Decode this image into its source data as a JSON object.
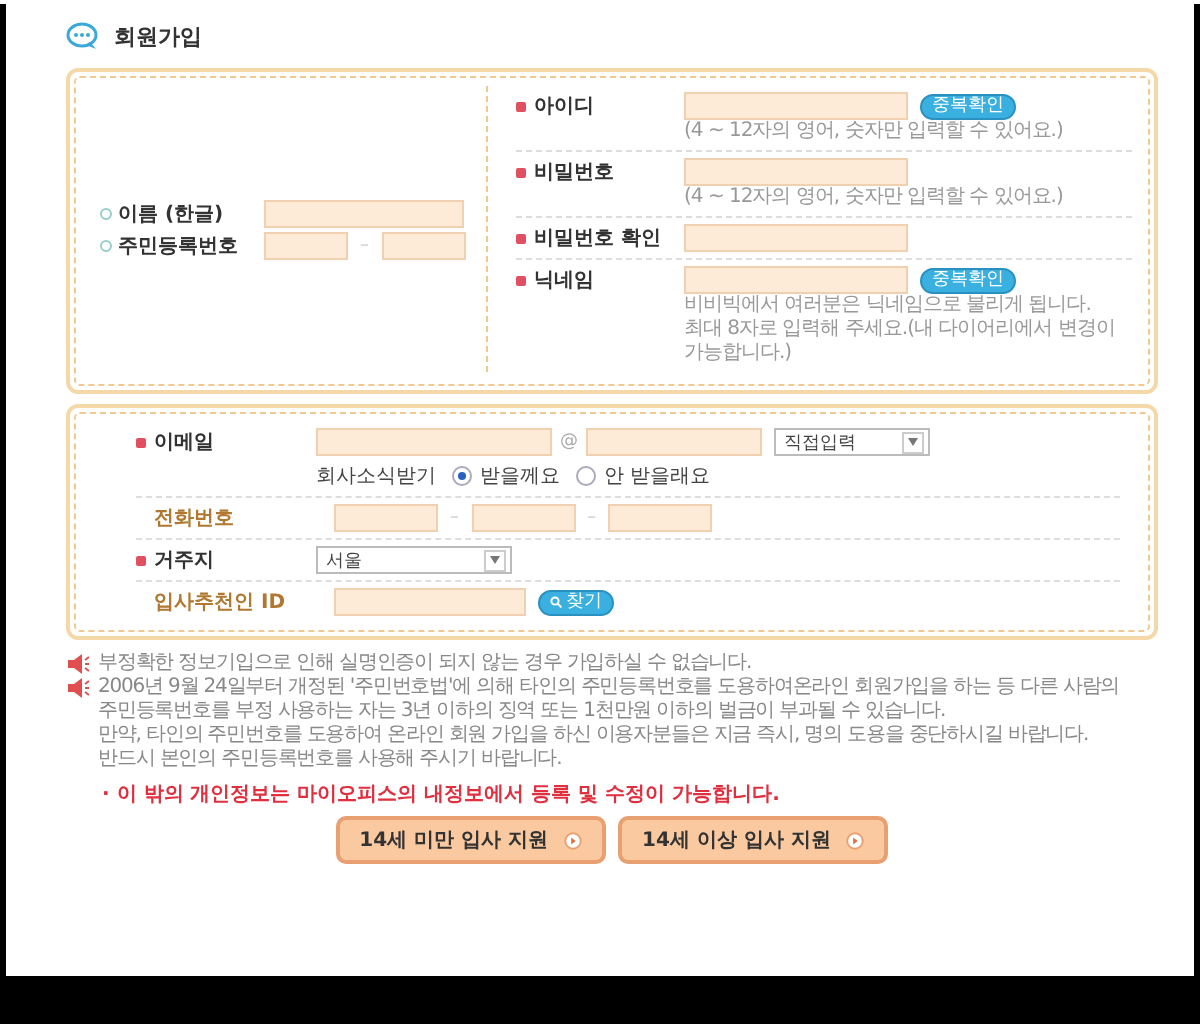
{
  "title": "회원가입",
  "basic_fields": [
    {
      "label": "이름 (한글)",
      "kind": "single"
    },
    {
      "label": "주민등록번호",
      "kind": "split",
      "separator": "–"
    }
  ],
  "account_fields": [
    {
      "label": "아이디",
      "button": "중복확인",
      "hints": [
        "(4 ~ 12자의 영어, 숫자만 입력할 수 있어요.)"
      ]
    },
    {
      "label": "비밀번호",
      "hints": [
        "(4 ~ 12자의 영어, 숫자만 입력할 수 있어요.)"
      ]
    },
    {
      "label": "비밀번호 확인"
    },
    {
      "label": "닉네임",
      "button": "중복확인",
      "hints": [
        "비비빅에서 여러분은 닉네임으로 불리게 됩니다.",
        "최대 8자로 입력해 주세요.(내 다이어리에서 변경이 가능합니다.)"
      ]
    }
  ],
  "contact_fields": [
    {
      "kind": "email",
      "label": "이메일",
      "required": true,
      "at": "@",
      "select": "직접입력",
      "newsletter": {
        "label": "회사소식받기",
        "options": [
          {
            "label": "받을께요",
            "selected": true
          },
          {
            "label": "안 받을래요",
            "selected": false
          }
        ]
      }
    },
    {
      "kind": "phone",
      "label": "전화번호",
      "required": false,
      "separators": [
        "–",
        "–"
      ]
    },
    {
      "kind": "select",
      "label": "거주지",
      "required": true,
      "select": "서울"
    },
    {
      "kind": "search",
      "label": "입사추천인 ID",
      "required": false,
      "button": "찾기"
    }
  ],
  "notices": [
    {
      "lines": [
        "부정확한 정보기입으로 인해 실명인증이 되지 않는 경우 가입하실 수 없습니다."
      ]
    },
    {
      "lines": [
        "2006년 9월 24일부터 개정된 '주민번호법'에 의해 타인의 주민등록번호를 도용하여온라인 회원가입을 하는 등 다른 사람의",
        "주민등록번호를 부정 사용하는 자는 3년 이하의 징역 또는 1천만원 이하의 벌금이 부과될 수 있습니다.",
        "만약, 타인의 주민번호를 도용하여 온라인 회원 가입을 하신 이용자분들은 지금 즉시, 명의 도용을 중단하시길 바랍니다.",
        "반드시 본인의 주민등록번호를 사용해 주시기 바랍니다."
      ]
    }
  ],
  "red_note": "· 이 밖의 개인정보는 마이오피스의 내정보에서 등록 및 수정이 가능합니다.",
  "buttons": [
    "14세 미만 입사 지원",
    "14세 이상 입사 지원"
  ]
}
